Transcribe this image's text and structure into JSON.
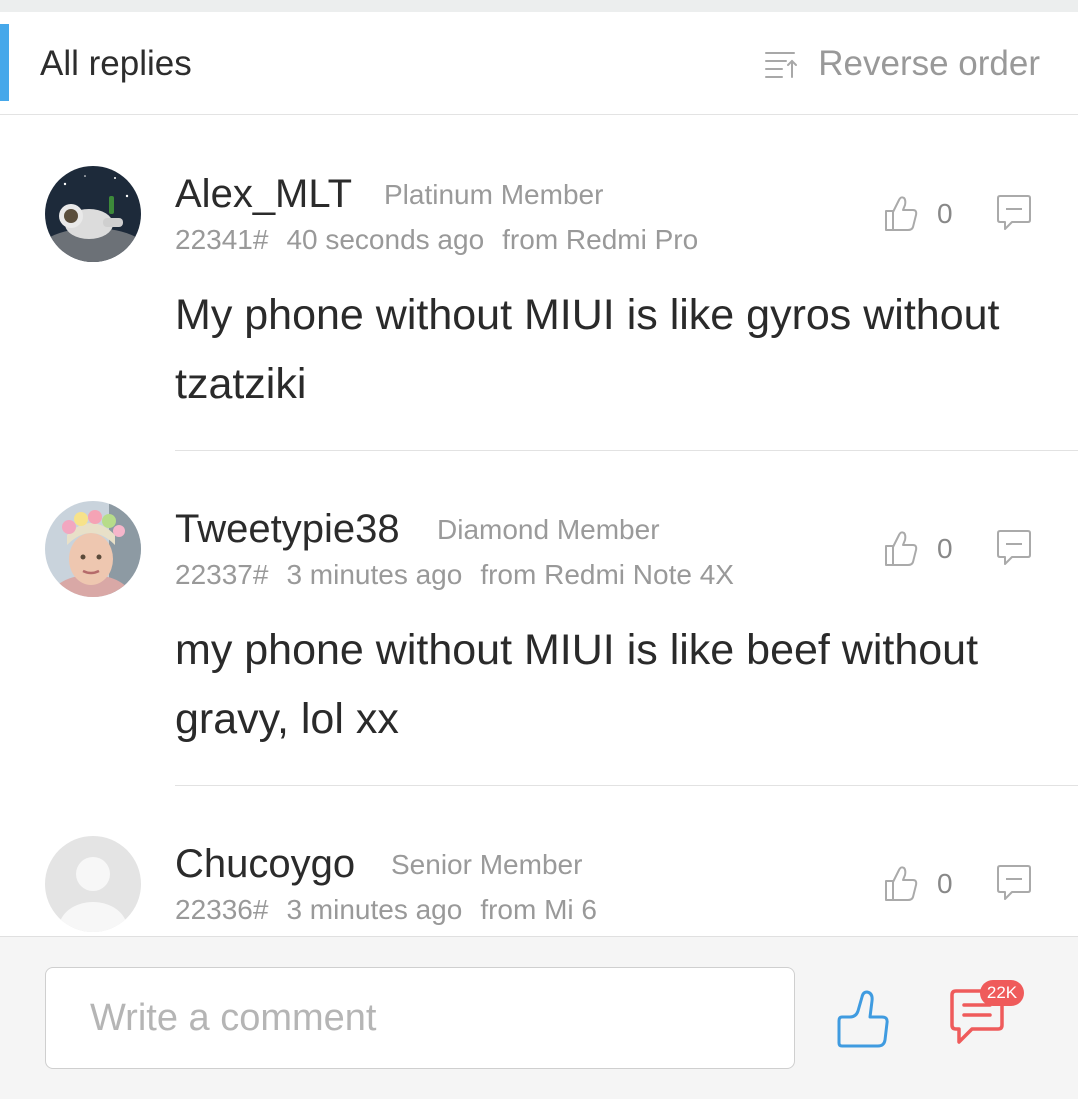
{
  "header": {
    "title": "All replies",
    "sort_label": "Reverse order",
    "accent_color": "#46a8ea"
  },
  "replies": [
    {
      "username": "Alex_MLT",
      "rank": "Platinum Member",
      "floor": "22341#",
      "time": "40 seconds ago",
      "device": "from Redmi Pro",
      "text": "My phone without MIUI is like gyros without tzatziki",
      "likes": "0",
      "avatar": "astronaut-avatar"
    },
    {
      "username": "Tweetypie38",
      "rank": "Diamond Member",
      "floor": "22337#",
      "time": "3 minutes ago",
      "device": "from Redmi Note 4X",
      "text": "my phone without MIUI is like beef without gravy, lol xx",
      "likes": "0",
      "avatar": "flower-crown-avatar"
    },
    {
      "username": "Chucoygo",
      "rank": "Senior Member",
      "floor": "22336#",
      "time": "3 minutes ago",
      "device": "from Mi 6",
      "text": "",
      "likes": "0",
      "avatar": "default-avatar"
    }
  ],
  "footer": {
    "input_placeholder": "Write a comment",
    "comment_count_badge": "22K",
    "like_color": "#3f9be0",
    "comment_color": "#ef5b5b"
  }
}
